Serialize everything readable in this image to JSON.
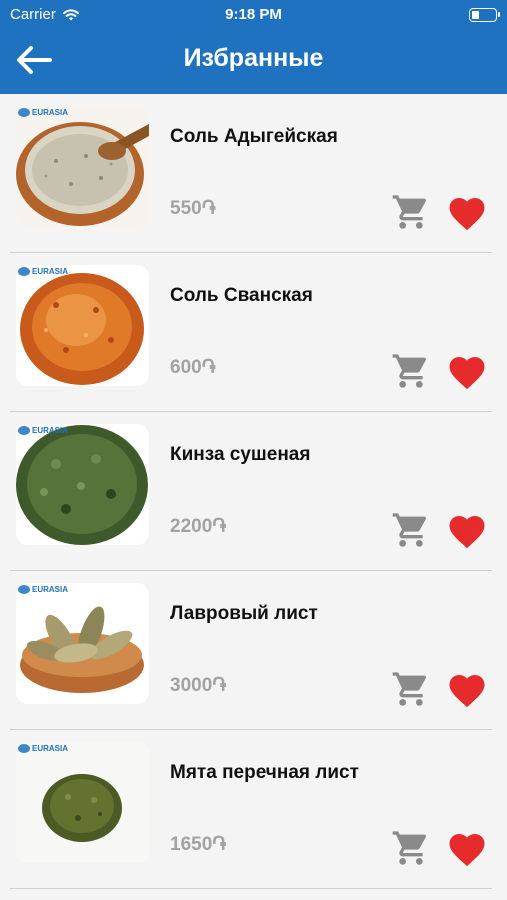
{
  "status_bar": {
    "carrier": "Carrier",
    "time": "9:18 PM",
    "wifi_icon": "wifi-icon",
    "battery_icon": "battery-icon"
  },
  "header": {
    "title": "Избранные",
    "back_icon": "arrow-left-icon",
    "background": "#1f72bf"
  },
  "colors": {
    "price": "#a2a2a2",
    "cart_icon": "#8a8a8a",
    "heart_icon": "#e52b2b"
  },
  "brand_label": "EURASIA",
  "products": [
    {
      "name": "Соль Адыгейская",
      "price": "550֏",
      "image": "adyghe-salt-in-bowl",
      "favorite": true
    },
    {
      "name": "Соль Сванская",
      "price": "600֏",
      "image": "svan-salt-pile",
      "favorite": true
    },
    {
      "name": "Кинза сушеная",
      "price": "2200֏",
      "image": "dried-cilantro-pile",
      "favorite": true
    },
    {
      "name": "Лавровый лист",
      "price": "3000֏",
      "image": "bay-leaves-in-bowl",
      "favorite": true
    },
    {
      "name": "Мята перечная лист",
      "price": "1650֏",
      "image": "peppermint-leaf-pile",
      "favorite": true
    }
  ]
}
